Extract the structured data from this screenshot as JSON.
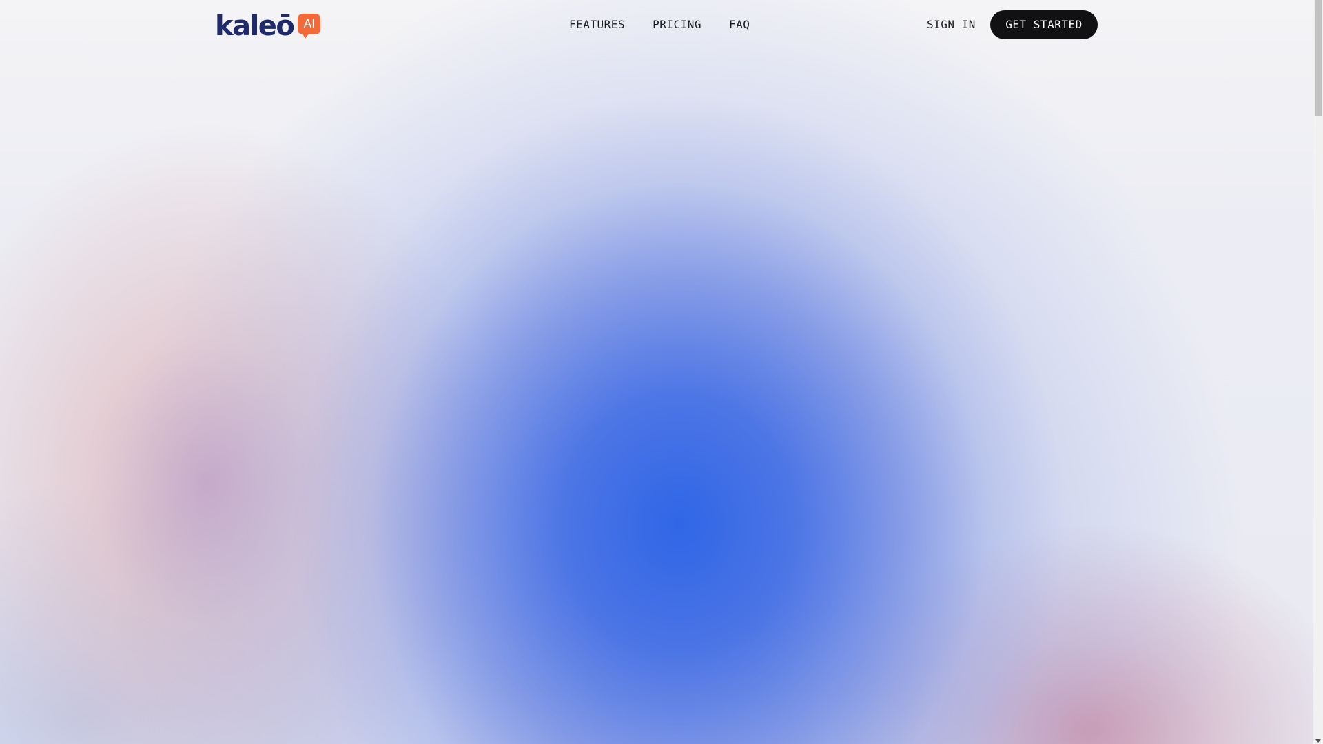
{
  "header": {
    "logo": {
      "wordmark": "kaleō",
      "badge": "AI",
      "brand_color": "#1f2a6b",
      "badge_color": "#f06a3a"
    },
    "nav": [
      {
        "label": "FEATURES"
      },
      {
        "label": "PRICING"
      },
      {
        "label": "FAQ"
      }
    ],
    "sign_in_label": "SIGN IN",
    "cta_label": "GET STARTED",
    "cta_color": "#111114"
  },
  "hero": {
    "accent_blue": "#3066e6",
    "accent_pink": "#cd8296",
    "accent_peach": "#f0c8c0"
  }
}
